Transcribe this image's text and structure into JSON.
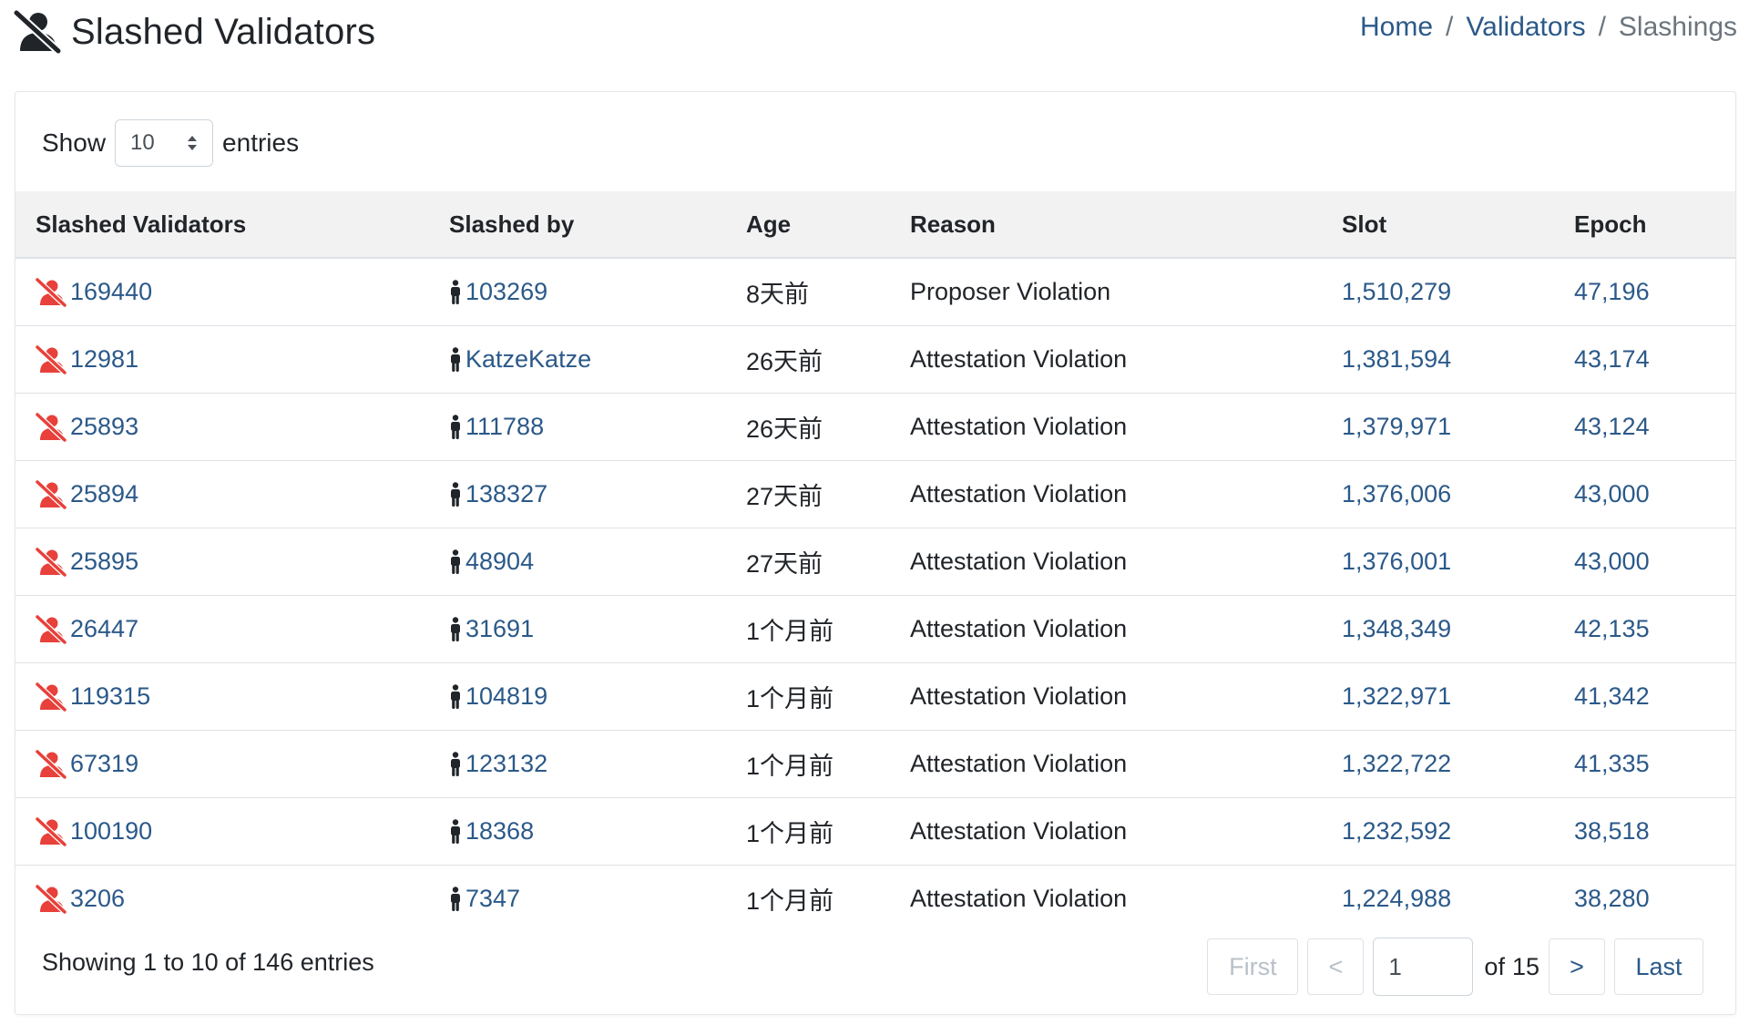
{
  "header": {
    "title": "Slashed Validators",
    "title_icon": "user-slash-icon",
    "breadcrumb": [
      "Home",
      "Validators",
      "Slashings"
    ]
  },
  "length": {
    "show_label": "Show",
    "value": "10",
    "entries_label": "entries"
  },
  "table": {
    "columns": [
      "Slashed Validators",
      "Slashed by",
      "Age",
      "Reason",
      "Slot",
      "Epoch"
    ],
    "rows": [
      {
        "validator": "169440",
        "slashed_by": "103269",
        "age": "8天前",
        "reason": "Proposer Violation",
        "slot": "1,510,279",
        "epoch": "47,196"
      },
      {
        "validator": "12981",
        "slashed_by": "KatzeKatze",
        "age": "26天前",
        "reason": "Attestation Violation",
        "slot": "1,381,594",
        "epoch": "43,174"
      },
      {
        "validator": "25893",
        "slashed_by": "111788",
        "age": "26天前",
        "reason": "Attestation Violation",
        "slot": "1,379,971",
        "epoch": "43,124"
      },
      {
        "validator": "25894",
        "slashed_by": "138327",
        "age": "27天前",
        "reason": "Attestation Violation",
        "slot": "1,376,006",
        "epoch": "43,000"
      },
      {
        "validator": "25895",
        "slashed_by": "48904",
        "age": "27天前",
        "reason": "Attestation Violation",
        "slot": "1,376,001",
        "epoch": "43,000"
      },
      {
        "validator": "26447",
        "slashed_by": "31691",
        "age": "1个月前",
        "reason": "Attestation Violation",
        "slot": "1,348,349",
        "epoch": "42,135"
      },
      {
        "validator": "119315",
        "slashed_by": "104819",
        "age": "1个月前",
        "reason": "Attestation Violation",
        "slot": "1,322,971",
        "epoch": "41,342"
      },
      {
        "validator": "67319",
        "slashed_by": "123132",
        "age": "1个月前",
        "reason": "Attestation Violation",
        "slot": "1,322,722",
        "epoch": "41,335"
      },
      {
        "validator": "100190",
        "slashed_by": "18368",
        "age": "1个月前",
        "reason": "Attestation Violation",
        "slot": "1,232,592",
        "epoch": "38,518"
      },
      {
        "validator": "3206",
        "slashed_by": "7347",
        "age": "1个月前",
        "reason": "Attestation Violation",
        "slot": "1,224,988",
        "epoch": "38,280"
      }
    ]
  },
  "footer": {
    "info": "Showing 1 to 10 of 146 entries",
    "first": "First",
    "prev": "<",
    "page": "1",
    "of_label": "of",
    "total_pages": "15",
    "next": ">",
    "last": "Last"
  },
  "colors": {
    "link": "#2b5989",
    "slashed_icon": "#e8403a",
    "header_bg": "#f3f2f2"
  }
}
